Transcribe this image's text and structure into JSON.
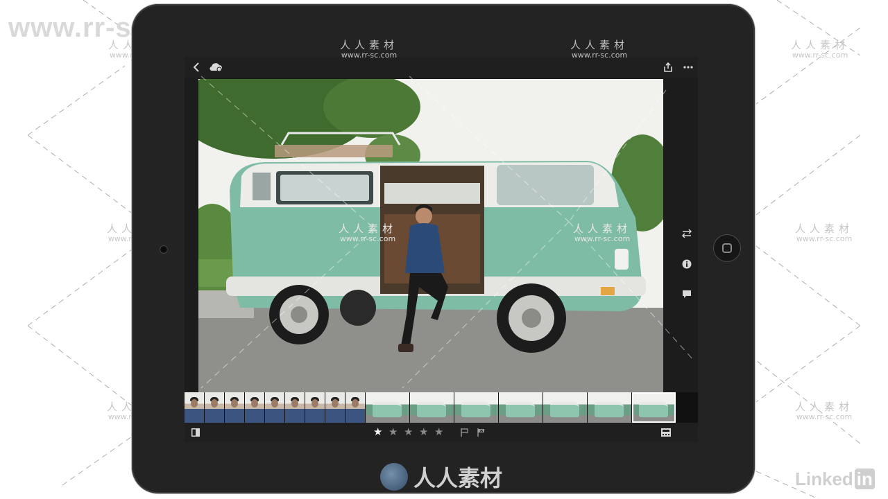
{
  "watermarks": {
    "site_url_large": "www.rr-sc.com",
    "cn_label": "人人素材",
    "url_small": "www.rr-sc.com",
    "brand_text": "人人素材",
    "linkedin_word": "Linked",
    "linkedin_in": "in"
  },
  "app": {
    "topbar": {
      "back_icon": "chevron-left-icon",
      "cloud_icon": "cloud-sync-icon",
      "share_icon": "share-icon",
      "more_icon": "more-dots-icon"
    },
    "right_rail": [
      {
        "name": "adjust-sliders-icon",
        "glyph": "⇄"
      },
      {
        "name": "info-icon",
        "glyph": "i"
      },
      {
        "name": "comment-icon",
        "glyph": "▪"
      }
    ],
    "filmstrip": {
      "portrait_count": 9,
      "van_count": 7,
      "selected_index": 15
    },
    "rating": {
      "value": 1,
      "max": 5
    },
    "flags": [
      "pick-flag-icon",
      "reject-flag-icon"
    ],
    "colors": {
      "device_bezel": "#232323",
      "screen_bg": "#1c1c1c",
      "bar_bg": "#1f1f1f",
      "icon": "#d8d8d8",
      "star_filled": "#ffffff",
      "star_empty": "#8a8a8a",
      "van_body": "#7fbca5",
      "watermark": "#c7c7c7"
    }
  }
}
